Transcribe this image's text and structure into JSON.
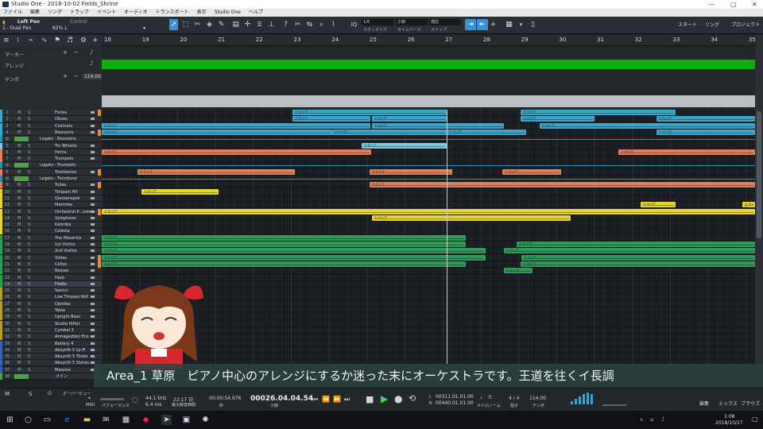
{
  "window": {
    "title": "Studio One - 2018-10-02 Fields_Shrine"
  },
  "menu": [
    "ファイル",
    "編集",
    "ソング",
    "トラック",
    "イベント",
    "オーディオ",
    "トランスポート",
    "表示",
    "Studio One",
    "ヘルプ"
  ],
  "toolbar": {
    "track_name": "Left Pan",
    "track_index_label": "1 - Dual Pan",
    "control_label": "Control",
    "pan_value": "62% L",
    "quantize": "1/8",
    "quantize_label": "クオンタイズ",
    "timebase": "小節",
    "timebase_label": "タイムベース",
    "snap": "適応",
    "snap_label": "スナップ",
    "start": "スタート",
    "song": "ソング",
    "project": "プロジェクト"
  },
  "left_header": {
    "marker": "マーカー",
    "arranger": "アレンジ",
    "tempo": "テンポ",
    "tempo_value": "114.00"
  },
  "ruler": [
    "18",
    "19",
    "20",
    "21",
    "22",
    "23",
    "24",
    "25",
    "26",
    "27",
    "28",
    "29",
    "30",
    "31",
    "32",
    "33",
    "34",
    "35"
  ],
  "tracks": [
    {
      "num": "1",
      "name": "Flutes",
      "color": "#3da5c9",
      "kind": "track",
      "expand": true
    },
    {
      "num": "2",
      "name": "Oboes",
      "color": "#3da5c9",
      "kind": "track"
    },
    {
      "num": "3",
      "name": "Clarinets",
      "color": "#3da5c9",
      "kind": "track"
    },
    {
      "num": "4",
      "name": "Bassoons",
      "color": "#3da5c9",
      "kind": "track",
      "expand": true
    },
    {
      "num": "",
      "name": "Legato - Bassoons",
      "color": "#2e8fb2",
      "kind": "auto"
    },
    {
      "num": "5",
      "name": "Tin Whistle",
      "color": "#7fc7db",
      "kind": "track"
    },
    {
      "num": "6",
      "name": "Horns",
      "color": "#e0805a",
      "kind": "track"
    },
    {
      "num": "7",
      "name": "Trumpets",
      "color": "#e0805a",
      "kind": "track"
    },
    {
      "num": "",
      "name": "Legato - Trumpets",
      "color": "#2e8fb2",
      "kind": "auto"
    },
    {
      "num": "8",
      "name": "Trombones",
      "color": "#e0805a",
      "kind": "track",
      "expand": true
    },
    {
      "num": "",
      "name": "Legato - Trombone",
      "color": "#2e8fb2",
      "kind": "auto"
    },
    {
      "num": "9",
      "name": "Tubas",
      "color": "#e0805a",
      "kind": "track",
      "expand": true
    },
    {
      "num": "10",
      "name": "Timpani Hit",
      "color": "#e6d435",
      "kind": "track"
    },
    {
      "num": "11",
      "name": "Glockenspiel",
      "color": "#e6d435",
      "kind": "track"
    },
    {
      "num": "12",
      "name": "Marimba",
      "color": "#e6d435",
      "kind": "track"
    },
    {
      "num": "13",
      "name": "Orchestral P...ssion",
      "color": "#e6d435",
      "kind": "track",
      "expand": true
    },
    {
      "num": "14",
      "name": "Xylophone",
      "color": "#e6d435",
      "kind": "track"
    },
    {
      "num": "15",
      "name": "Kalimba",
      "color": "#e6d435",
      "kind": "track"
    },
    {
      "num": "16",
      "name": "Celesta",
      "color": "#e6d435",
      "kind": "track"
    },
    {
      "num": "17",
      "name": "The Maverick",
      "color": "#2f9a5a",
      "kind": "track"
    },
    {
      "num": "18",
      "name": "1st Violins",
      "color": "#2f9a5a",
      "kind": "track"
    },
    {
      "num": "19",
      "name": "2nd Violins",
      "color": "#2f9a5a",
      "kind": "track"
    },
    {
      "num": "20",
      "name": "Violas",
      "color": "#2f9a5a",
      "kind": "track",
      "expand": true
    },
    {
      "num": "21",
      "name": "Cellos",
      "color": "#2f9a5a",
      "kind": "track",
      "expand": true
    },
    {
      "num": "22",
      "name": "Basses",
      "color": "#2f9a5a",
      "kind": "track"
    },
    {
      "num": "23",
      "name": "Harp",
      "color": "#2f9a5a",
      "kind": "track"
    },
    {
      "num": "24",
      "name": "Fiddle",
      "color": "#2f9a5a",
      "kind": "track",
      "selected": true
    },
    {
      "num": "25",
      "name": "Santur",
      "color": "#b0a030",
      "kind": "track"
    },
    {
      "num": "26",
      "name": "Low Timpani Roll",
      "color": "#b0a030",
      "kind": "track"
    },
    {
      "num": "27",
      "name": "Djembe",
      "color": "#b0a030",
      "kind": "track"
    },
    {
      "num": "28",
      "name": "Tabla",
      "color": "#b0a030",
      "kind": "track"
    },
    {
      "num": "29",
      "name": "Upright Bass",
      "color": "#b0a030",
      "kind": "track"
    },
    {
      "num": "30",
      "name": "Studio HiHat",
      "color": "#b0a030",
      "kind": "track"
    },
    {
      "num": "31",
      "name": "Cymbal 3",
      "color": "#b0a030",
      "kind": "track"
    },
    {
      "num": "32",
      "name": "Armageddon Ens",
      "color": "#b0a030",
      "kind": "track"
    },
    {
      "num": "33",
      "name": "Battery 4",
      "color": "#3c5fb0",
      "kind": "track"
    },
    {
      "num": "34",
      "name": "Absynth 5 Lo-Fi",
      "color": "#3c5fb0",
      "kind": "track"
    },
    {
      "num": "35",
      "name": "Absynth 5 Tinkle",
      "color": "#3c5fb0",
      "kind": "track"
    },
    {
      "num": "36",
      "name": "Absynth 5 Stereo",
      "color": "#3c5fb0",
      "kind": "track"
    },
    {
      "num": "37",
      "name": "Massive",
      "color": "#3c5fb0",
      "kind": "track"
    },
    {
      "num": "38",
      "name": "メイン",
      "color": "#4fa04a",
      "kind": "folder"
    }
  ],
  "clip_label": "トラック",
  "subtitle": "Area_1 草原　ピアノ中心のアレンジにするか迷った末にオーケストラです。王道を往くイ長調",
  "transport": {
    "midi": "MIDI",
    "perf": "パフォーマンス",
    "rate": "44.1 kHz",
    "latency": "6.4 ms",
    "time": "22:17 日",
    "rec_time_label": "最大録音時間",
    "seconds": "00:00:54.676",
    "seconds_unit": "秒",
    "bars": "00026.04.04.54",
    "bars_unit": "小節",
    "loop_l": "00311.01.01.00",
    "loop_r": "00440.01.01.00",
    "metro": "メトロノーム",
    "sig": "4 / 4",
    "sig_label": "拍子",
    "tempo": "114.00",
    "tempo_label": "テンポ",
    "edit": "編集",
    "mix": "ミックス",
    "browse": "ブラウズ",
    "mark_l": "L",
    "mark_r": "R"
  },
  "bottom_left": {
    "m": "M",
    "s": "S",
    "overview": "オーバービュー"
  },
  "taskbar": {
    "time": "1:08",
    "date": "2018/10/27"
  }
}
